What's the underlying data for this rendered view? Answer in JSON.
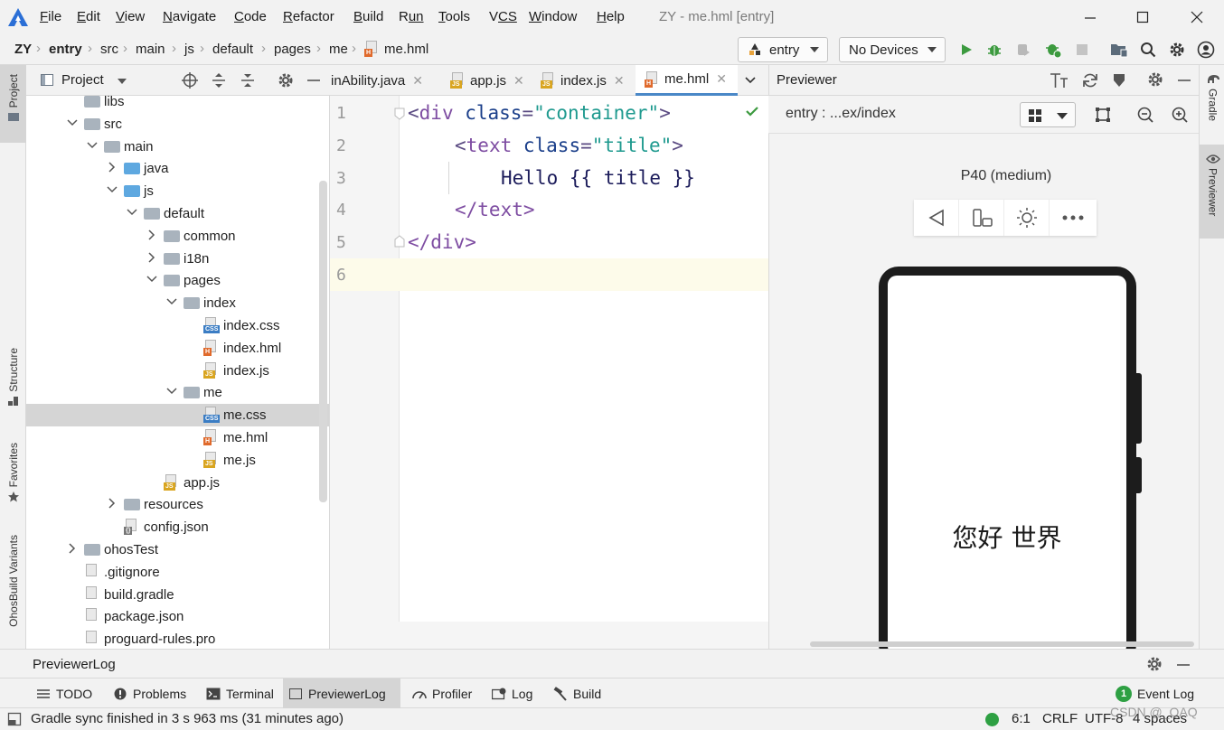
{
  "window": {
    "title": "ZY - me.hml [entry]",
    "menu": [
      {
        "label": "File",
        "u": "F",
        "rest": "ile"
      },
      {
        "label": "Edit",
        "u": "E",
        "rest": "dit"
      },
      {
        "label": "View",
        "u": "V",
        "rest": "iew"
      },
      {
        "label": "Navigate",
        "u": "N",
        "rest": "avigate"
      },
      {
        "label": "Code",
        "u": "C",
        "rest": "ode"
      },
      {
        "label": "Refactor",
        "u": "R",
        "rest": "efactor"
      },
      {
        "label": "Build",
        "u": "B",
        "rest": "uild"
      },
      {
        "label": "Run",
        "u": "R",
        "rest": "un"
      },
      {
        "label": "Tools",
        "u": "T",
        "rest": "ools"
      },
      {
        "label": "VCS",
        "u": "V",
        "rest": "CS"
      },
      {
        "label": "Window",
        "u": "W",
        "rest": "indow"
      },
      {
        "label": "Help",
        "u": "H",
        "rest": "elp"
      }
    ]
  },
  "breadcrumb": [
    "ZY",
    "entry",
    "src",
    "main",
    "js",
    "default",
    "pages",
    "me",
    "me.hml"
  ],
  "toolbar": {
    "module_combo": "entry",
    "device_combo": "No Devices"
  },
  "project_panel": {
    "title": "Project",
    "tree": [
      {
        "label": "libs",
        "kind": "folder"
      },
      {
        "label": "src",
        "kind": "folder"
      },
      {
        "label": "main",
        "kind": "folder"
      },
      {
        "label": "java",
        "kind": "folder-blue"
      },
      {
        "label": "js",
        "kind": "folder-blue"
      },
      {
        "label": "default",
        "kind": "folder"
      },
      {
        "label": "common",
        "kind": "folder"
      },
      {
        "label": "i18n",
        "kind": "folder"
      },
      {
        "label": "pages",
        "kind": "folder"
      },
      {
        "label": "index",
        "kind": "folder"
      },
      {
        "label": "index.css",
        "kind": "css"
      },
      {
        "label": "index.hml",
        "kind": "hml"
      },
      {
        "label": "index.js",
        "kind": "js"
      },
      {
        "label": "me",
        "kind": "folder"
      },
      {
        "label": "me.css",
        "kind": "css"
      },
      {
        "label": "me.hml",
        "kind": "hml"
      },
      {
        "label": "me.js",
        "kind": "js"
      },
      {
        "label": "app.js",
        "kind": "js"
      },
      {
        "label": "resources",
        "kind": "folder"
      },
      {
        "label": "config.json",
        "kind": "json"
      },
      {
        "label": "ohosTest",
        "kind": "folder"
      },
      {
        "label": ".gitignore",
        "kind": "file"
      },
      {
        "label": "build.gradle",
        "kind": "gradle"
      },
      {
        "label": "package.json",
        "kind": "file"
      },
      {
        "label": "proguard-rules.pro",
        "kind": "file"
      }
    ]
  },
  "left_strip": {
    "project": "Project",
    "structure": "Structure",
    "favorites": "Favorites",
    "ohos_variants": "OhosBuild Variants"
  },
  "right_strip": {
    "gradle": "Gradle",
    "previewer": "Previewer"
  },
  "editor": {
    "tabs": [
      {
        "label": "inAbility.java"
      },
      {
        "label": "app.js"
      },
      {
        "label": "index.js"
      },
      {
        "label": "me.hml",
        "active": true
      }
    ],
    "line_numbers": [
      "1",
      "2",
      "3",
      "4",
      "5",
      "6"
    ],
    "code": {
      "l1": {
        "open": "<",
        "tag": "div",
        "attr": " class",
        "eq": "=",
        "val": "\"container\"",
        "close": ">"
      },
      "l2": {
        "open": "<",
        "tag": "text",
        "attr": " class",
        "eq": "=",
        "val": "\"title\"",
        "close": ">"
      },
      "l3": {
        "text": "Hello {{ title }}"
      },
      "l4": {
        "text": "</text>"
      },
      "l5": {
        "text": "</div>"
      }
    }
  },
  "previewer": {
    "title": "Previewer",
    "path": "entry : ...ex/index",
    "device_label": "P40 (medium)",
    "screen_text": "您好 世界"
  },
  "bottom": {
    "log_title": "PreviewerLog",
    "tools": [
      {
        "label": "TODO"
      },
      {
        "label": "Problems"
      },
      {
        "label": "Terminal"
      },
      {
        "label": "PreviewerLog",
        "active": true
      },
      {
        "label": "Profiler"
      },
      {
        "label": "Log"
      },
      {
        "label": "Build"
      }
    ],
    "event_log": "Event Log",
    "event_count": "1"
  },
  "status": {
    "message": "Gradle sync finished in 3 s 963 ms (31 minutes ago)",
    "position": "6:1",
    "line_sep": "CRLF",
    "encoding": "UTF-8",
    "indent": "4 spaces",
    "watermark": "CSDN @_QAQ"
  },
  "colors": {
    "accent": "#4a88c7",
    "run_green": "#3c9a3f",
    "status_green": "#2ea043",
    "selection": "#d5d5d5"
  }
}
